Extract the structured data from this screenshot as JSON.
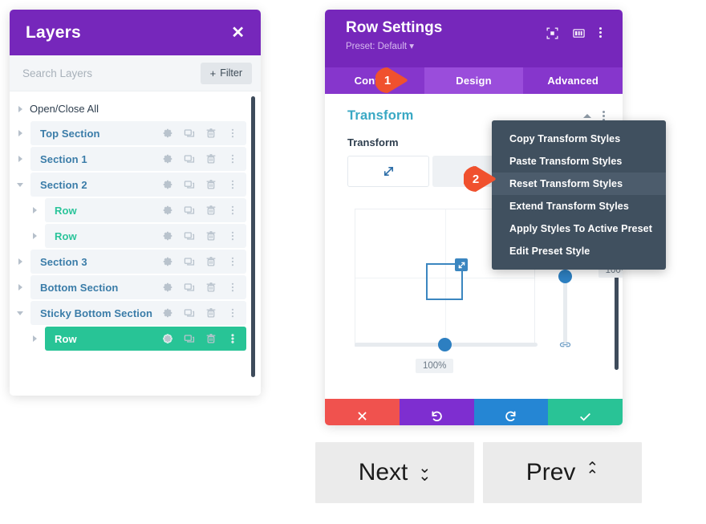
{
  "layers_panel": {
    "title": "Layers",
    "close_icon": "close-icon",
    "search": {
      "placeholder": "Search Layers",
      "value": ""
    },
    "filter_button": {
      "label": "Filter",
      "plus": "+"
    },
    "open_close_all": "Open/Close All",
    "row_icons": [
      "gear-icon",
      "duplicate-icon",
      "trash-icon",
      "more-vertical-icon"
    ],
    "items": [
      {
        "label": "Top Section",
        "indent": false,
        "caret": "right",
        "selected": false,
        "color": "blue"
      },
      {
        "label": "Section 1",
        "indent": false,
        "caret": "right",
        "selected": false,
        "color": "blue"
      },
      {
        "label": "Section 2",
        "indent": false,
        "caret": "down",
        "selected": false,
        "color": "blue"
      },
      {
        "label": "Row",
        "indent": true,
        "caret": "right",
        "selected": false,
        "color": "teal"
      },
      {
        "label": "Row",
        "indent": true,
        "caret": "right",
        "selected": false,
        "color": "teal"
      },
      {
        "label": "Section 3",
        "indent": false,
        "caret": "right",
        "selected": false,
        "color": "blue"
      },
      {
        "label": "Bottom Section",
        "indent": false,
        "caret": "right",
        "selected": false,
        "color": "blue"
      },
      {
        "label": "Sticky Bottom Section",
        "indent": false,
        "caret": "down",
        "selected": false,
        "color": "blue"
      },
      {
        "label": "Row",
        "indent": true,
        "caret": "right",
        "selected": true,
        "color": "white"
      }
    ]
  },
  "settings_panel": {
    "title": "Row Settings",
    "preset": "Preset: Default",
    "header_icons": [
      "focus-icon",
      "layout-columns-icon",
      "more-vertical-icon"
    ],
    "tabs": [
      {
        "label": "Content",
        "active": false
      },
      {
        "label": "Design",
        "active": true
      },
      {
        "label": "Advanced",
        "active": false
      }
    ],
    "section": {
      "title": "Transform",
      "collapse_icon": "chevron-up-icon",
      "menu_icon": "more-vertical-icon"
    },
    "field_label": "Transform",
    "transform_tabs": [
      {
        "icon": "scale-icon",
        "active": true
      },
      {
        "icon": "translate-icon",
        "active": false
      },
      {
        "icon": "rotate-icon",
        "active": false
      }
    ],
    "scale": {
      "horizontal_value": "100%",
      "vertical_value": "100%",
      "link_icon": "link-icon",
      "handle_icon": "resize-handle-icon"
    },
    "footer_buttons": [
      {
        "name": "cancel",
        "icon": "close-icon"
      },
      {
        "name": "undo",
        "icon": "undo-icon"
      },
      {
        "name": "redo",
        "icon": "redo-icon"
      },
      {
        "name": "save",
        "icon": "check-icon"
      }
    ]
  },
  "context_menu": {
    "items": [
      {
        "label": "Copy Transform Styles",
        "highlighted": false
      },
      {
        "label": "Paste Transform Styles",
        "highlighted": false
      },
      {
        "label": "Reset Transform Styles",
        "highlighted": true
      },
      {
        "label": "Extend Transform Styles",
        "highlighted": false
      },
      {
        "label": "Apply Styles To Active Preset",
        "highlighted": false
      },
      {
        "label": "Edit Preset Style",
        "highlighted": false
      }
    ]
  },
  "badges": [
    {
      "number": "1"
    },
    {
      "number": "2"
    }
  ],
  "nav_buttons": [
    {
      "label": "Next",
      "chevron": "chevron-double-down-icon"
    },
    {
      "label": "Prev",
      "chevron": "chevron-double-up-icon"
    }
  ],
  "colors": {
    "purple": "#7627bb",
    "tab_purple": "#8636cc",
    "tab_active_purple": "#9a4ddb",
    "teal": "#28c496",
    "badge_orange": "#f0512e",
    "menu_dark": "#40505f",
    "link_blue": "#3a7ca8",
    "slider_blue": "#2d7fc1",
    "section_title": "#39a8c4"
  }
}
